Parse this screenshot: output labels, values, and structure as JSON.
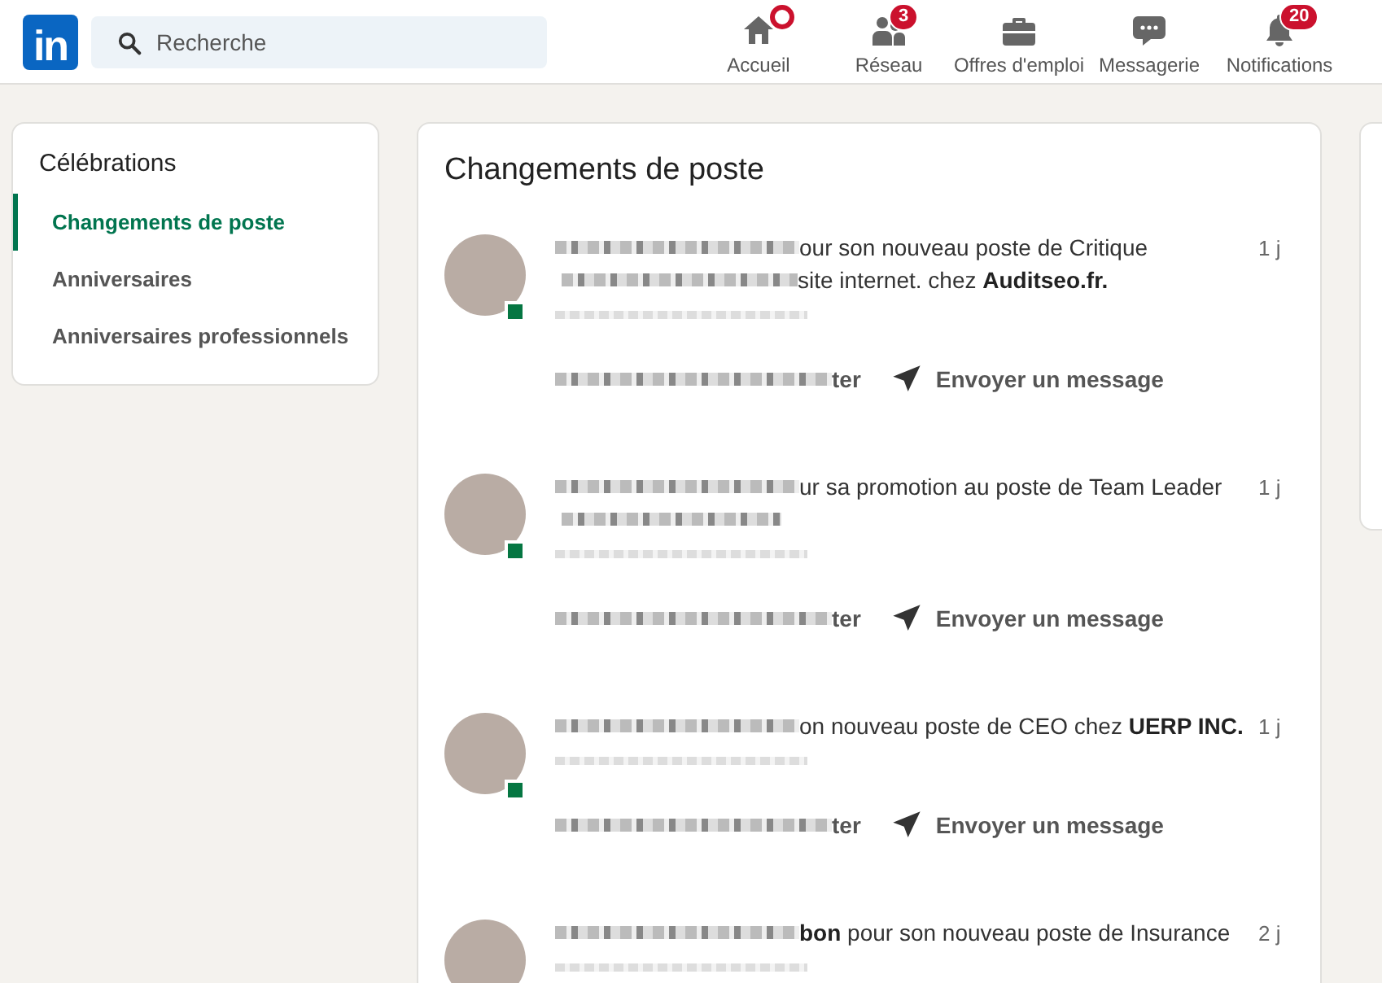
{
  "header": {
    "logo": "in",
    "search": {
      "placeholder": "Recherche"
    },
    "nav": [
      {
        "kind": "home",
        "label": "Accueil",
        "dot": true
      },
      {
        "kind": "people",
        "label": "Réseau",
        "dot": false,
        "badge": "3"
      },
      {
        "kind": "briefcase",
        "label": "Offres d'emploi",
        "dot": false
      },
      {
        "kind": "chat",
        "label": "Messagerie",
        "dot": false
      },
      {
        "kind": "bell",
        "label": "Notifications",
        "dot": false,
        "badge": "20"
      }
    ]
  },
  "sidebar": {
    "title": "Célébrations",
    "items": [
      {
        "label": "Changements de poste",
        "selected": true
      },
      {
        "label": "Anniversaires",
        "selected": false
      },
      {
        "label": "Anniversaires professionnels",
        "selected": false
      }
    ]
  },
  "main": {
    "title": "Changements de poste",
    "items": [
      {
        "lines": [
          {
            "kind": "text",
            "text": "our son nouveau poste de Critique"
          },
          {
            "kind": "text",
            "text": "site internet. chez **Auditseo.fr.**"
          }
        ],
        "time": "1 j",
        "action_fragment": "ter",
        "message_button": "Envoyer un message"
      },
      {
        "lines": [
          {
            "kind": "text",
            "text": "ur sa promotion au poste de Team Leader"
          },
          {
            "kind": "redacted"
          }
        ],
        "time": "1 j",
        "action_fragment": "ter",
        "message_button": "Envoyer un message"
      },
      {
        "lines": [
          {
            "kind": "text",
            "text": "on nouveau poste de CEO chez **UERP INC.**"
          }
        ],
        "time": "1 j",
        "action_fragment": "ter",
        "message_button": "Envoyer un message"
      },
      {
        "lines": [
          {
            "kind": "text",
            "text": "**bon** pour son nouveau poste de Insurance"
          }
        ],
        "time": "2 j"
      }
    ]
  }
}
